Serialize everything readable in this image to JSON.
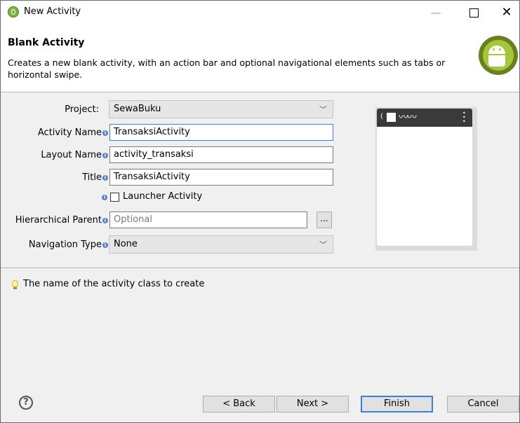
{
  "window": {
    "title": "New Activity",
    "minimize": "—",
    "close": "✕"
  },
  "header": {
    "title": "Blank Activity",
    "description": "Creates a new blank activity, with an action bar and optional navigational elements such as tabs or horizontal swipe."
  },
  "form": {
    "project_label": "Project:",
    "project_value": "SewaBuku",
    "activity_name_label": "Activity Name",
    "activity_name_value": "TransaksiActivity",
    "layout_name_label": "Layout Name",
    "layout_name_value": "activity_transaksi",
    "title_label": "Title",
    "title_value": "TransaksiActivity",
    "launcher_label": "Launcher Activity",
    "launcher_checked": false,
    "hierarchical_parent_label": "Hierarchical Parent",
    "hierarchical_parent_placeholder": "Optional",
    "browse_label": "...",
    "navigation_type_label": "Navigation Type",
    "navigation_type_value": "None",
    "info_glyph": "i"
  },
  "status": {
    "message": "The name of the activity class to create"
  },
  "footer": {
    "help": "?",
    "back": "< Back",
    "next": "Next >",
    "finish": "Finish",
    "cancel": "Cancel"
  },
  "icons": {
    "app": "android-adt-icon",
    "info": "info-icon",
    "bulb": "lightbulb-icon",
    "help": "help-icon",
    "dropdown": "chevron-down-icon"
  },
  "colors": {
    "accent": "#3c7fd8",
    "android_green": "#a4c639",
    "preview_bar": "#3a3a3a"
  }
}
